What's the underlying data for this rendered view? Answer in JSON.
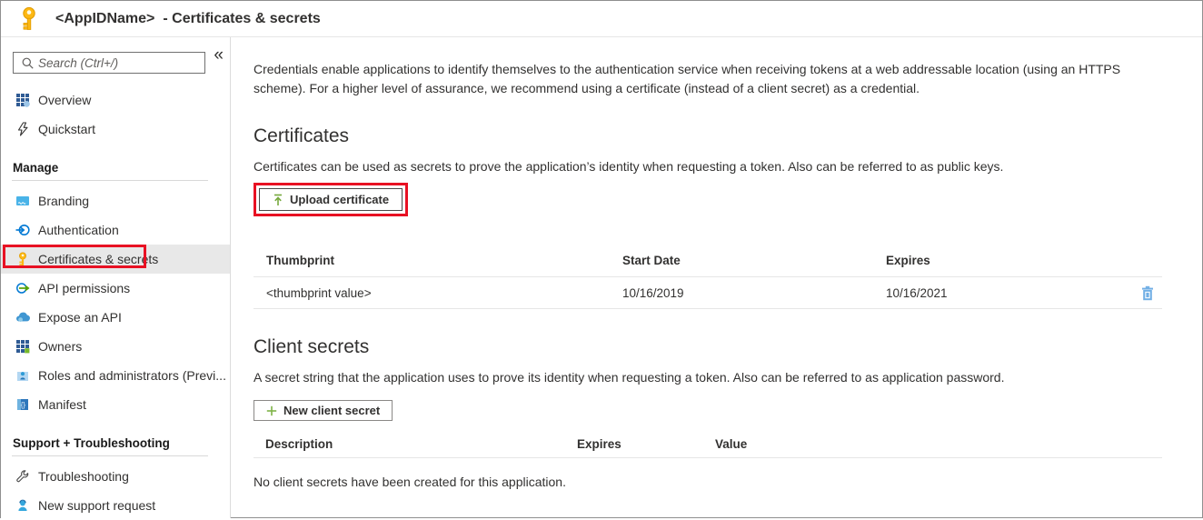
{
  "header": {
    "app_name": "<AppIDName>",
    "title_suffix": "- Certificates & secrets"
  },
  "sidebar": {
    "search_placeholder": "Search (Ctrl+/)",
    "collapse_icon": "«",
    "manage_header": "Manage",
    "support_header": "Support + Troubleshooting",
    "items": [
      {
        "label": "Overview"
      },
      {
        "label": "Quickstart"
      },
      {
        "label": "Branding"
      },
      {
        "label": "Authentication"
      },
      {
        "label": "Certificates & secrets",
        "selected": true
      },
      {
        "label": "API permissions"
      },
      {
        "label": "Expose an API"
      },
      {
        "label": "Owners"
      },
      {
        "label": "Roles and administrators (Previ..."
      },
      {
        "label": "Manifest"
      },
      {
        "label": "Troubleshooting"
      },
      {
        "label": "New support request"
      }
    ]
  },
  "main": {
    "intro": "Credentials enable applications to identify themselves to the authentication service when receiving tokens at a web addressable location (using an HTTPS scheme). For a higher level of assurance, we recommend using a certificate (instead of a client secret) as a credential.",
    "certificates": {
      "title": "Certificates",
      "description": "Certificates can be used as secrets to prove the application’s identity when requesting a token. Also can be referred to as public keys.",
      "upload_button": "Upload certificate",
      "table": {
        "headers": [
          "Thumbprint",
          "Start Date",
          "Expires"
        ],
        "rows": [
          {
            "thumbprint": "<thumbprint value>",
            "start_date": "10/16/2019",
            "expires": "10/16/2021"
          }
        ]
      }
    },
    "client_secrets": {
      "title": "Client secrets",
      "description": "A secret string that the application uses to prove its identity when requesting a token. Also can be referred to as application password.",
      "new_button": "New client secret",
      "table": {
        "headers": [
          "Description",
          "Expires",
          "Value"
        ]
      },
      "empty_message": "No client secrets have been created for this application."
    }
  },
  "colors": {
    "annotation_red": "#e81123",
    "selected_item_bg": "#e8e8e8",
    "accent_blue": "#0078d4",
    "key_gold": "#fdb813",
    "trash_blue": "#71afe5",
    "green_accent": "#76a83d"
  }
}
